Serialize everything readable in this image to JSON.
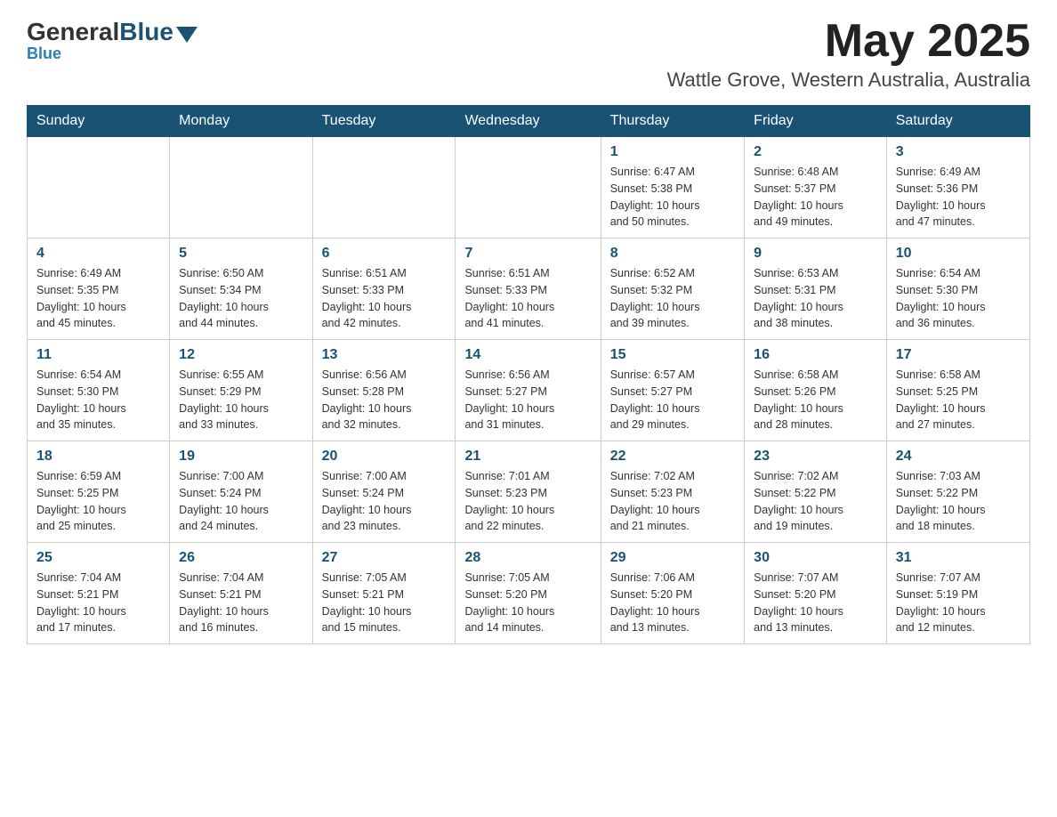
{
  "header": {
    "logo": {
      "general": "General",
      "blue": "Blue"
    },
    "title": "May 2025",
    "location": "Wattle Grove, Western Australia, Australia"
  },
  "days_of_week": [
    "Sunday",
    "Monday",
    "Tuesday",
    "Wednesday",
    "Thursday",
    "Friday",
    "Saturday"
  ],
  "weeks": [
    [
      {
        "day": "",
        "info": ""
      },
      {
        "day": "",
        "info": ""
      },
      {
        "day": "",
        "info": ""
      },
      {
        "day": "",
        "info": ""
      },
      {
        "day": "1",
        "info": "Sunrise: 6:47 AM\nSunset: 5:38 PM\nDaylight: 10 hours\nand 50 minutes."
      },
      {
        "day": "2",
        "info": "Sunrise: 6:48 AM\nSunset: 5:37 PM\nDaylight: 10 hours\nand 49 minutes."
      },
      {
        "day": "3",
        "info": "Sunrise: 6:49 AM\nSunset: 5:36 PM\nDaylight: 10 hours\nand 47 minutes."
      }
    ],
    [
      {
        "day": "4",
        "info": "Sunrise: 6:49 AM\nSunset: 5:35 PM\nDaylight: 10 hours\nand 45 minutes."
      },
      {
        "day": "5",
        "info": "Sunrise: 6:50 AM\nSunset: 5:34 PM\nDaylight: 10 hours\nand 44 minutes."
      },
      {
        "day": "6",
        "info": "Sunrise: 6:51 AM\nSunset: 5:33 PM\nDaylight: 10 hours\nand 42 minutes."
      },
      {
        "day": "7",
        "info": "Sunrise: 6:51 AM\nSunset: 5:33 PM\nDaylight: 10 hours\nand 41 minutes."
      },
      {
        "day": "8",
        "info": "Sunrise: 6:52 AM\nSunset: 5:32 PM\nDaylight: 10 hours\nand 39 minutes."
      },
      {
        "day": "9",
        "info": "Sunrise: 6:53 AM\nSunset: 5:31 PM\nDaylight: 10 hours\nand 38 minutes."
      },
      {
        "day": "10",
        "info": "Sunrise: 6:54 AM\nSunset: 5:30 PM\nDaylight: 10 hours\nand 36 minutes."
      }
    ],
    [
      {
        "day": "11",
        "info": "Sunrise: 6:54 AM\nSunset: 5:30 PM\nDaylight: 10 hours\nand 35 minutes."
      },
      {
        "day": "12",
        "info": "Sunrise: 6:55 AM\nSunset: 5:29 PM\nDaylight: 10 hours\nand 33 minutes."
      },
      {
        "day": "13",
        "info": "Sunrise: 6:56 AM\nSunset: 5:28 PM\nDaylight: 10 hours\nand 32 minutes."
      },
      {
        "day": "14",
        "info": "Sunrise: 6:56 AM\nSunset: 5:27 PM\nDaylight: 10 hours\nand 31 minutes."
      },
      {
        "day": "15",
        "info": "Sunrise: 6:57 AM\nSunset: 5:27 PM\nDaylight: 10 hours\nand 29 minutes."
      },
      {
        "day": "16",
        "info": "Sunrise: 6:58 AM\nSunset: 5:26 PM\nDaylight: 10 hours\nand 28 minutes."
      },
      {
        "day": "17",
        "info": "Sunrise: 6:58 AM\nSunset: 5:25 PM\nDaylight: 10 hours\nand 27 minutes."
      }
    ],
    [
      {
        "day": "18",
        "info": "Sunrise: 6:59 AM\nSunset: 5:25 PM\nDaylight: 10 hours\nand 25 minutes."
      },
      {
        "day": "19",
        "info": "Sunrise: 7:00 AM\nSunset: 5:24 PM\nDaylight: 10 hours\nand 24 minutes."
      },
      {
        "day": "20",
        "info": "Sunrise: 7:00 AM\nSunset: 5:24 PM\nDaylight: 10 hours\nand 23 minutes."
      },
      {
        "day": "21",
        "info": "Sunrise: 7:01 AM\nSunset: 5:23 PM\nDaylight: 10 hours\nand 22 minutes."
      },
      {
        "day": "22",
        "info": "Sunrise: 7:02 AM\nSunset: 5:23 PM\nDaylight: 10 hours\nand 21 minutes."
      },
      {
        "day": "23",
        "info": "Sunrise: 7:02 AM\nSunset: 5:22 PM\nDaylight: 10 hours\nand 19 minutes."
      },
      {
        "day": "24",
        "info": "Sunrise: 7:03 AM\nSunset: 5:22 PM\nDaylight: 10 hours\nand 18 minutes."
      }
    ],
    [
      {
        "day": "25",
        "info": "Sunrise: 7:04 AM\nSunset: 5:21 PM\nDaylight: 10 hours\nand 17 minutes."
      },
      {
        "day": "26",
        "info": "Sunrise: 7:04 AM\nSunset: 5:21 PM\nDaylight: 10 hours\nand 16 minutes."
      },
      {
        "day": "27",
        "info": "Sunrise: 7:05 AM\nSunset: 5:21 PM\nDaylight: 10 hours\nand 15 minutes."
      },
      {
        "day": "28",
        "info": "Sunrise: 7:05 AM\nSunset: 5:20 PM\nDaylight: 10 hours\nand 14 minutes."
      },
      {
        "day": "29",
        "info": "Sunrise: 7:06 AM\nSunset: 5:20 PM\nDaylight: 10 hours\nand 13 minutes."
      },
      {
        "day": "30",
        "info": "Sunrise: 7:07 AM\nSunset: 5:20 PM\nDaylight: 10 hours\nand 13 minutes."
      },
      {
        "day": "31",
        "info": "Sunrise: 7:07 AM\nSunset: 5:19 PM\nDaylight: 10 hours\nand 12 minutes."
      }
    ]
  ]
}
